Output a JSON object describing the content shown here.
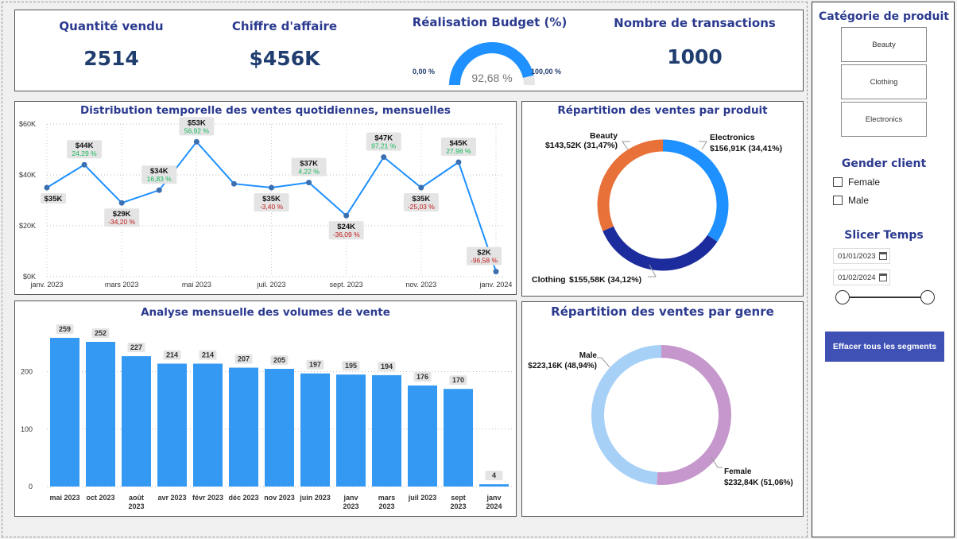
{
  "kpis": {
    "quantite": {
      "title": "Quantité vendu",
      "value": "2514"
    },
    "ca": {
      "title": "Chiffre d'affaire",
      "value": "$456K"
    },
    "budget": {
      "title": "Réalisation Budget (%)",
      "value": "92,68 %",
      "min": "0,00 %",
      "max": "100,00 %",
      "fraction": 0.9268
    },
    "transactions": {
      "title": "Nombre de transactions",
      "value": "1000"
    }
  },
  "sidebar": {
    "category_title": "Catégorie de produit",
    "categories": [
      "Beauty",
      "Clothing",
      "Electronics"
    ],
    "gender_title": "Gender client",
    "genders": [
      "Female",
      "Male"
    ],
    "time_title": "Slicer Temps",
    "date_start": "01/01/2023",
    "date_end": "01/02/2024",
    "clear_label": "Effacer tous les segments",
    "icons": {
      "calendar": "calendar-icon",
      "checkbox": "checkbox-icon"
    }
  },
  "colors": {
    "accent_blue": "#1e90ff",
    "title_navy": "#2b3a8f",
    "beauty": "#e8713a",
    "clothing": "#1d2c9c",
    "electronics": "#1e90ff",
    "male": "#a7d0f7",
    "female": "#c597cc",
    "positive": "#15b85a",
    "negative": "#c01a1a",
    "button": "#3f51b5"
  },
  "chart_data": [
    {
      "type": "line",
      "title": "Distribution temporelle des ventes quotidiennes, mensuelles",
      "y_ticks": [
        "$0K",
        "$20K",
        "$40K",
        "$60K"
      ],
      "ylim": [
        0,
        60
      ],
      "x_ticks": [
        "janv. 2023",
        "mars 2023",
        "mai 2023",
        "juil. 2023",
        "sept. 2023",
        "nov. 2023",
        "janv. 2024"
      ],
      "x": [
        "2023-01",
        "2023-02",
        "2023-03",
        "2023-04",
        "2023-05",
        "2023-06",
        "2023-07",
        "2023-08",
        "2023-09",
        "2023-10",
        "2023-11",
        "2023-12",
        "2024-01"
      ],
      "values": [
        35,
        44,
        29,
        34,
        53,
        36.5,
        35,
        37,
        24,
        47,
        35,
        45,
        2
      ],
      "value_labels": [
        "$35K",
        "$44K",
        "$29K",
        "$34K",
        "$53K",
        "",
        "$35K",
        "$37K",
        "$24K",
        "$47K",
        "$35K",
        "$45K",
        "$2K"
      ],
      "change_labels": [
        "",
        "24,29 %",
        "-34,20 %",
        "16,83 %",
        "56,92 %",
        "",
        "-3,40 %",
        "4,22 %",
        "-36,09 %",
        "97,21 %",
        "-25,03 %",
        "27,98 %",
        "-96,58 %"
      ],
      "grid": true
    },
    {
      "type": "bar",
      "title": "Analyse mensuelle des volumes de vente",
      "categories": [
        "mai 2023",
        "oct 2023",
        "août 2023",
        "avr 2023",
        "févr 2023",
        "déc 2023",
        "nov 2023",
        "juin 2023",
        "janv 2023",
        "mars 2023",
        "juil 2023",
        "sept 2023",
        "janv 2024"
      ],
      "values": [
        259,
        252,
        227,
        214,
        214,
        207,
        205,
        197,
        195,
        194,
        176,
        170,
        4
      ],
      "y_ticks": [
        "0",
        "100",
        "200"
      ],
      "ylim": [
        0,
        270
      ],
      "grid": true
    },
    {
      "type": "pie",
      "title": "Répartition des ventes par produit",
      "labels": [
        "Electronics",
        "Clothing",
        "Beauty"
      ],
      "values": [
        156.91,
        155.58,
        143.52
      ],
      "value_labels": [
        "$156,91K (34,41%)",
        "$155,58K (34,12%)",
        "$143,52K (31,47%)"
      ],
      "colors": [
        "#1e90ff",
        "#1d2c9c",
        "#e8713a"
      ]
    },
    {
      "type": "pie",
      "title": "Répartition des ventes par genre",
      "labels": [
        "Female",
        "Male"
      ],
      "values": [
        232.84,
        223.16
      ],
      "value_labels": [
        "$232,84K (51,06%)",
        "$223,16K (48,94%)"
      ],
      "colors": [
        "#c597cc",
        "#a7d0f7"
      ]
    }
  ]
}
